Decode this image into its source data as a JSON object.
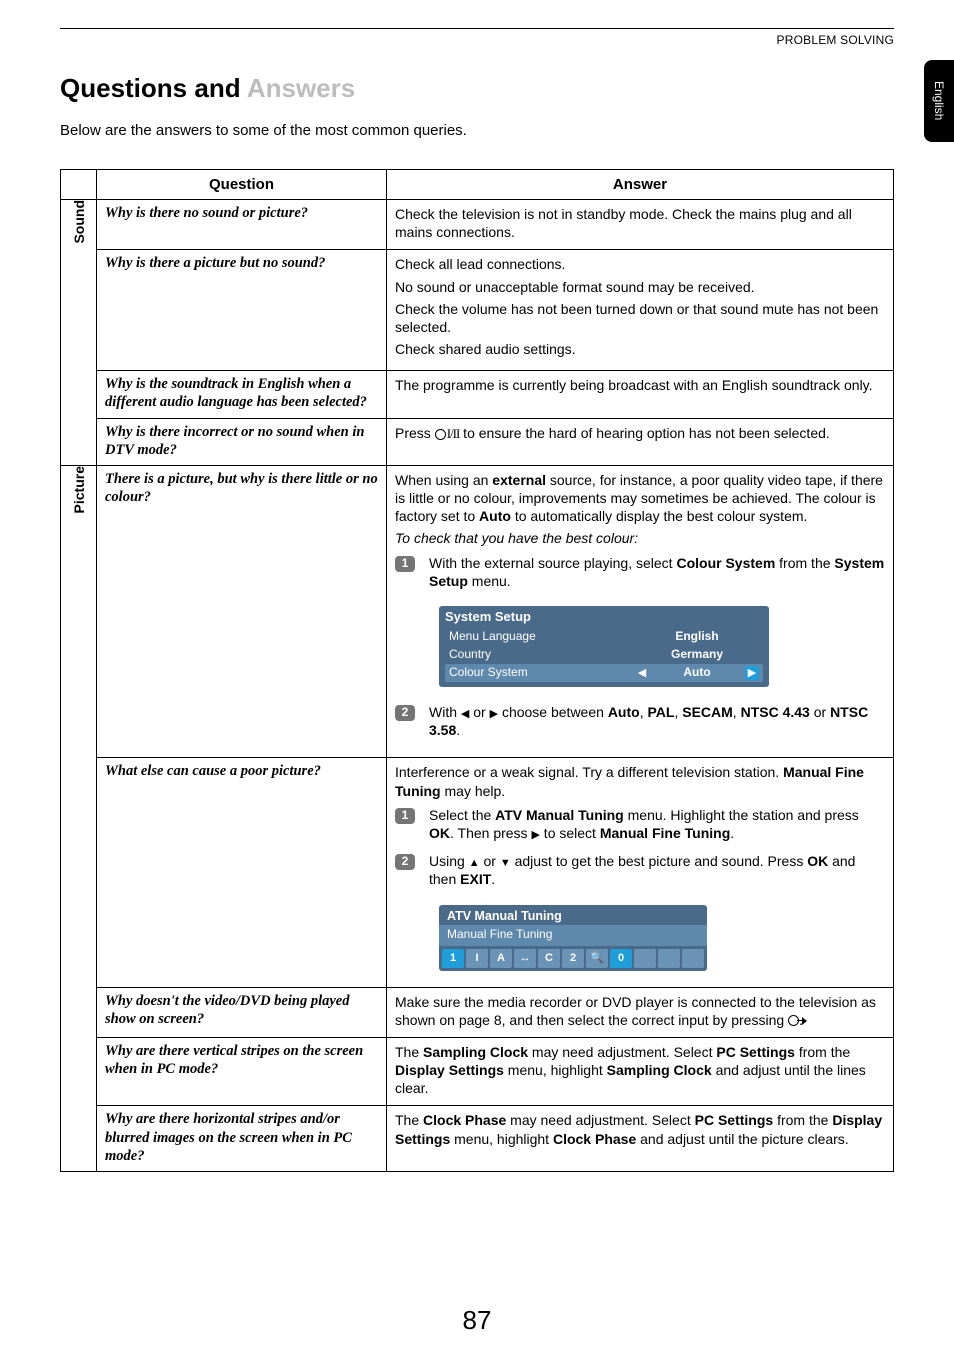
{
  "header": {
    "section": "PROBLEM SOLVING",
    "lang_tab": "English"
  },
  "title": {
    "part1": "Questions and ",
    "part2": "Answers"
  },
  "intro": "Below are the answers to some of the most common queries.",
  "table": {
    "head_q": "Question",
    "head_a": "Answer",
    "cat_sound": "Sound",
    "cat_picture": "Picture"
  },
  "sound": {
    "r1_q": "Why is there no sound or picture?",
    "r1_a": "Check the television is not in standby mode. Check the mains plug and all mains connections.",
    "r2_q": "Why is there a picture but no sound?",
    "r2_a1": "Check all lead connections.",
    "r2_a2": "No sound or unacceptable format sound may be received.",
    "r2_a3": "Check the volume has not been turned down or that sound mute has not been selected.",
    "r2_a4": "Check shared audio settings.",
    "r3_q": "Why is the soundtrack in English when a different audio language has been selected?",
    "r3_a": "The programme is currently being broadcast with an English soundtrack only.",
    "r4_q": "Why is there incorrect or no sound when in DTV mode?",
    "r4_a_pre": "Press ",
    "r4_a_post": " to ensure the hard of hearing option has not been selected."
  },
  "picture": {
    "r1_q": "There is a picture, but why is there little or no colour?",
    "r1_a_p1_a": "When using an ",
    "r1_a_p1_b": "external",
    "r1_a_p1_c": " source, for instance, a poor quality video tape, if there is little or no colour, improvements may sometimes be achieved. The colour is factory set to ",
    "r1_a_p1_d": "Auto",
    "r1_a_p1_e": " to automatically display the best colour system.",
    "r1_a_p2": "To check that you have the best colour:",
    "r1_s1_a": "With the external source playing, select ",
    "r1_s1_b": "Colour System",
    "r1_s1_c": " from the ",
    "r1_s1_d": "System Setup",
    "r1_s1_e": " menu.",
    "menu_title": "System Setup",
    "menu_r1_l": "Menu Language",
    "menu_r1_v": "English",
    "menu_r2_l": "Country",
    "menu_r2_v": "Germany",
    "menu_r3_l": "Colour System",
    "menu_r3_v": "Auto",
    "r1_s2_a": "With ",
    "r1_s2_b": " or ",
    "r1_s2_c": " choose between ",
    "r1_s2_d": "Auto",
    "r1_s2_e": ", ",
    "r1_s2_f": "PAL",
    "r1_s2_g": ", ",
    "r1_s2_h": "SECAM",
    "r1_s2_i": ", ",
    "r1_s2_j": "NTSC 4.43",
    "r1_s2_k": " or ",
    "r1_s2_l": "NTSC 3.58",
    "r1_s2_m": ".",
    "r2_q": "What else can cause a poor picture?",
    "r2_a_p1_a": "Interference or a weak signal. Try a different television station. ",
    "r2_a_p1_b": "Manual Fine Tuning",
    "r2_a_p1_c": " may help.",
    "r2_s1_a": "Select the ",
    "r2_s1_b": "ATV Manual Tuning",
    "r2_s1_c": " menu. Highlight the station and press ",
    "r2_s1_d": "OK",
    "r2_s1_e": ". Then press ",
    "r2_s1_f": " to select ",
    "r2_s1_g": "Manual Fine Tuning",
    "r2_s1_h": ".",
    "r2_s2_a": "Using ",
    "r2_s2_b": " or ",
    "r2_s2_c": " adjust to get the best picture and sound. Press ",
    "r2_s2_d": "OK",
    "r2_s2_e": " and then ",
    "r2_s2_f": "EXIT",
    "r2_s2_g": ".",
    "atv_title": "ATV Manual Tuning",
    "atv_sub": "Manual Fine Tuning",
    "atv_cells": [
      "1",
      "I",
      "A",
      "↔",
      "C",
      "2",
      "🔍",
      "0",
      "",
      "",
      ""
    ],
    "r3_q": "Why doesn't the video/DVD being played show on screen?",
    "r3_a_a": "Make sure the media recorder or DVD player is connected to the television as shown on page 8, and then select the correct input by pressing ",
    "r3_a_b": ".",
    "r4_q": "Why are there vertical stripes on the screen when in PC mode?",
    "r4_a_a": "The ",
    "r4_a_b": "Sampling Clock",
    "r4_a_c": " may need adjustment. Select ",
    "r4_a_d": "PC Settings",
    "r4_a_e": " from the ",
    "r4_a_f": "Display Settings",
    "r4_a_g": " menu, highlight ",
    "r4_a_h": "Sampling Clock",
    "r4_a_i": " and adjust until the lines clear.",
    "r5_q": "Why are there horizontal stripes and/or blurred images on the screen when in PC mode?",
    "r5_a_a": "The ",
    "r5_a_b": "Clock Phase",
    "r5_a_c": " may need adjustment. Select ",
    "r5_a_d": "PC Settings",
    "r5_a_e": " from the ",
    "r5_a_f": "Display Settings",
    "r5_a_g": " menu, highlight ",
    "r5_a_h": "Clock Phase",
    "r5_a_i": " and adjust until the picture clears."
  },
  "page_number": "87",
  "steps": {
    "n1": "1",
    "n2": "2"
  }
}
